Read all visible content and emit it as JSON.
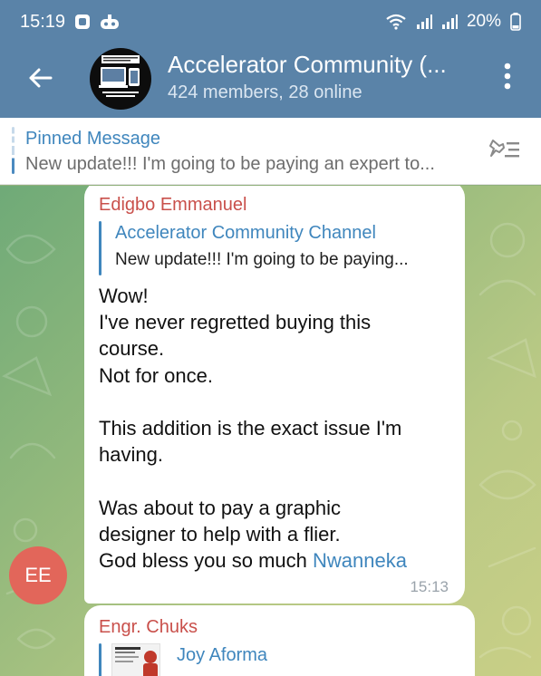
{
  "status_bar": {
    "time": "15:19",
    "battery": "20%",
    "icons": [
      "notification-square-icon",
      "game-controller-icon",
      "wifi-icon",
      "signal-icon",
      "signal-icon",
      "battery-icon"
    ]
  },
  "header": {
    "title": "Accelerator Community (...",
    "subtitle": "424 members, 28 online",
    "back_icon": "back-arrow-icon",
    "menu_icon": "more-vertical-icon"
  },
  "pinned": {
    "title": "Pinned Message",
    "text": "New update!!!  I'm going to be paying an expert to...",
    "icon": "pin-list-icon"
  },
  "messages": [
    {
      "sender": "Edigbo Emmanuel",
      "avatar_initials": "EE",
      "reply": {
        "title": "Accelerator Community Channel",
        "text": "New update!!!  I'm going to be paying..."
      },
      "lines": [
        "Wow!",
        "I've never regretted buying this",
        "course.",
        "Not for once.",
        "",
        "This addition is the exact issue I'm",
        "having.",
        "",
        "Was about to pay a graphic",
        "designer to help with a flier."
      ],
      "last_line_prefix": "God bless you so much ",
      "mention": "Nwanneka",
      "time": "15:13"
    },
    {
      "sender": "Engr. Chuks",
      "reply": {
        "title": "Joy Aforma"
      }
    }
  ],
  "colors": {
    "header_bg": "#5a83a8",
    "accent": "#3f86bd",
    "sender_name": "#c9504b",
    "avatar_ee": "#e2665a"
  }
}
